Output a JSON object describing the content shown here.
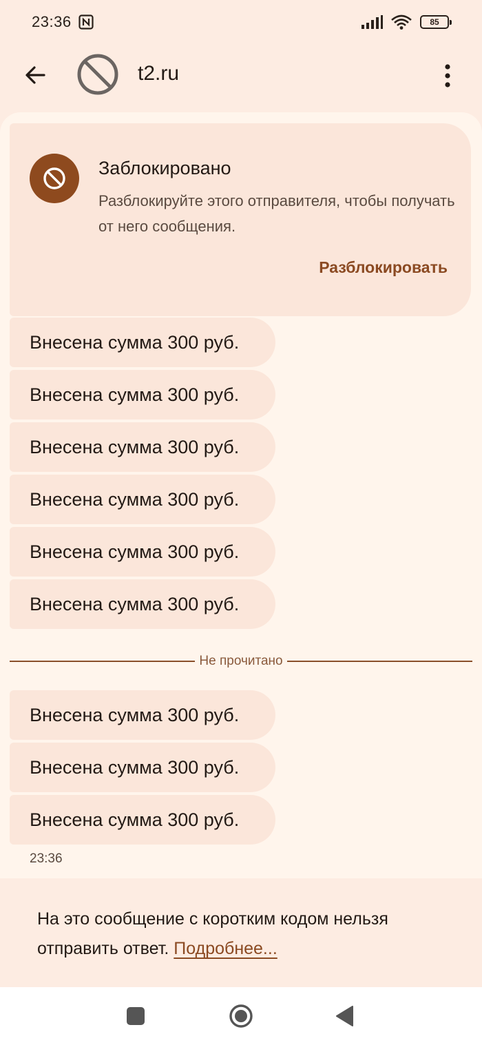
{
  "status_bar": {
    "time": "23:36",
    "battery_level": "85",
    "icons": [
      "nfc-icon",
      "signal-icon",
      "wifi-icon",
      "battery-icon"
    ]
  },
  "app_bar": {
    "title": "t2.ru",
    "back_icon": "arrow-back-icon",
    "avatar_icon": "blocked-icon",
    "menu_icon": "more-vert-icon"
  },
  "blocked_card": {
    "title": "Заблокировано",
    "description": "Разблокируйте этого отправителя, чтобы получать от него сообщения.",
    "unblock_label": "Разблокировать",
    "accent_color": "#8e4a1e"
  },
  "messages_read": [
    "Внесена сумма 300 руб.",
    "Внесена сумма 300 руб.",
    "Внесена сумма 300 руб.",
    "Внесена сумма 300 руб.",
    "Внесена сумма 300 руб.",
    "Внесена сумма 300 руб."
  ],
  "unread_divider": "Не прочитано",
  "messages_unread": [
    "Внесена сумма 300 руб.",
    "Внесена сумма 300 руб.",
    "Внесена сумма 300 руб."
  ],
  "last_timestamp": "23:36",
  "footer": {
    "notice": "На это сообщение с коротким кодом нельзя отправить ответ.",
    "link_label": "Подробнее..."
  },
  "nav_bar": {
    "icons": [
      "recents-icon",
      "home-icon",
      "back-icon"
    ]
  }
}
